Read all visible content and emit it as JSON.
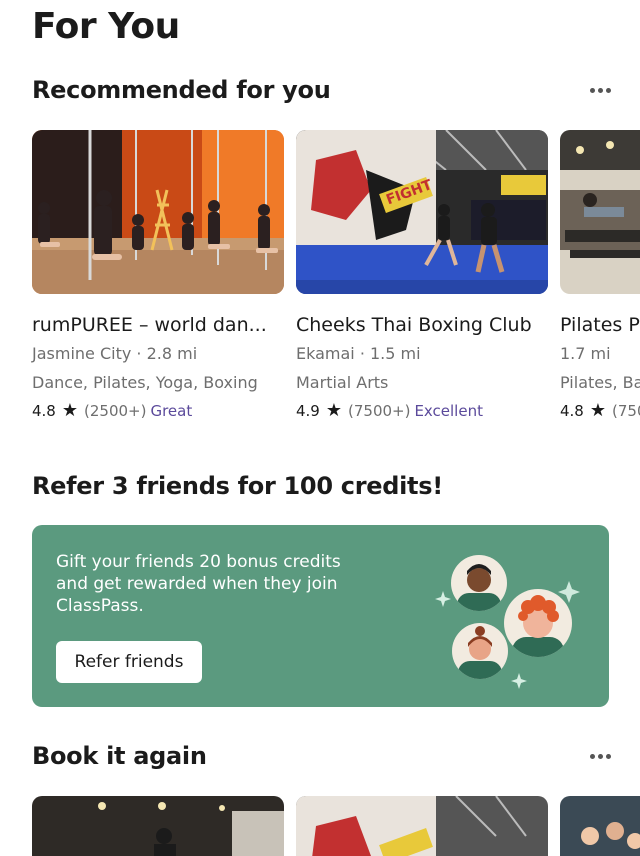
{
  "page": {
    "title": "For You"
  },
  "recommended": {
    "title": "Recommended for you",
    "cards": [
      {
        "name": "rumPUREE – world dan...",
        "location": "Jasmine City · 2.8 mi",
        "categories": "Dance, Pilates, Yoga, Boxing",
        "rating": "4.8",
        "reviews": "(2500+)",
        "quality": "Great"
      },
      {
        "name": "Cheeks Thai Boxing Club",
        "location": "Ekamai · 1.5 mi",
        "categories": "Martial Arts",
        "rating": "4.9",
        "reviews": "(7500+)",
        "quality": "Excellent"
      },
      {
        "name": "Pilates P",
        "location": "1.7 mi",
        "categories": "Pilates, Ba",
        "rating": "4.8",
        "reviews": "(750",
        "quality": ""
      }
    ]
  },
  "referral": {
    "title": "Refer 3 friends for 100 credits!",
    "description": "Gift your friends 20 bonus credits and get rewarded when they join ClassPass.",
    "button_label": "Refer friends"
  },
  "book_again": {
    "title": "Book it again"
  },
  "icons": {
    "more": "more-horizontal-icon",
    "star": "star-icon",
    "sparkle": "sparkle-icon"
  },
  "colors": {
    "referral_bg": "#5b9a7f",
    "quality_text": "#5b4a9b",
    "text_primary": "#1b1b1b",
    "text_secondary": "#6e6e6e"
  }
}
